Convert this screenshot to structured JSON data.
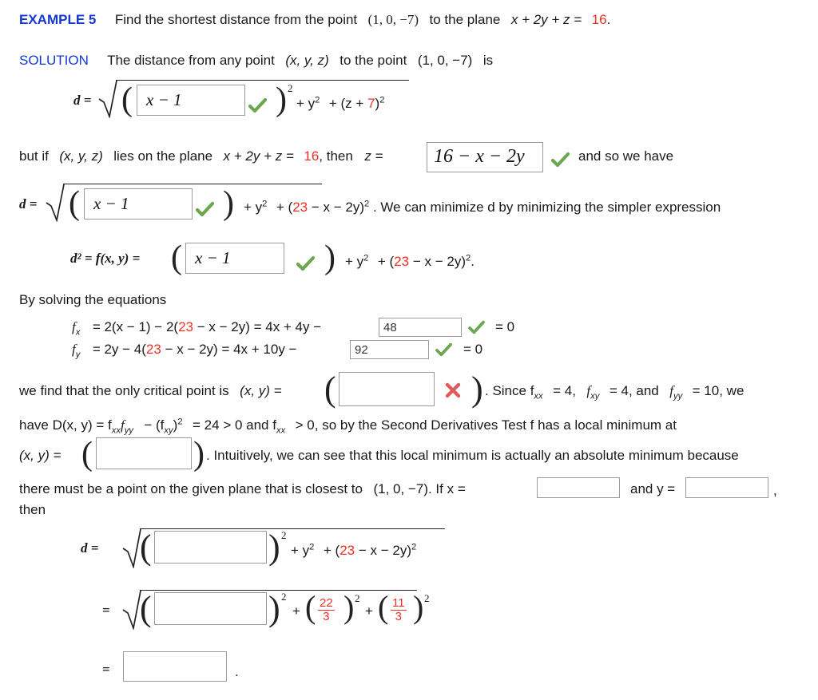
{
  "header": {
    "example_label": "EXAMPLE 5",
    "problem_pre": "Find the shortest distance from the point",
    "problem_point": "(1, 0, −7)",
    "problem_mid": "to the plane",
    "problem_plane": "x + 2y + z =",
    "problem_plane_value": "16",
    "problem_end": "."
  },
  "solution": {
    "label": "SOLUTION",
    "text_pre": "The distance from any point",
    "point_xyz": "(x, y, z)",
    "text_mid": "to the point",
    "point_val": "(1, 0, −7)",
    "text_end": "is"
  },
  "line_d1": {
    "lhs": "d =",
    "answer": "x − 1",
    "mark": "check",
    "after": "+ y",
    "after2": "+ (z +",
    "after_red": "7",
    "after3": ")",
    "exp": "2"
  },
  "line_plane": {
    "pre": "but if",
    "point_xyz": "(x, y, z)",
    "mid": "lies on the plane",
    "plane": "x + 2y + z =",
    "plane_val": "16",
    "then": ", then",
    "z_eq": "z =",
    "answer": "16 − x − 2y",
    "mark": "check",
    "tail": "and so we have"
  },
  "line_d2": {
    "lhs": "d =",
    "answer": "x − 1",
    "mark": "check",
    "mid": "+ y",
    "open": "+ (",
    "red_val": "23",
    "rest": "− x − 2y)",
    "tail": ". We can minimize d by minimizing the simpler expression"
  },
  "line_dsq": {
    "lhs": "d² = f(x, y) =",
    "answer": "x − 1",
    "mark": "check",
    "mid": "+ y",
    "open": "+ (",
    "red_val": "23",
    "rest": "− x − 2y)",
    "tail": "."
  },
  "solving": {
    "intro": "By solving the equations",
    "fx": {
      "name": "f",
      "sub": "x",
      "expr_pre": "= 2(x − 1) − 2(",
      "red_val": "23",
      "expr_mid": "− x − 2y) = 4x + 4y −",
      "answer": "48",
      "mark": "check",
      "result": "= 0"
    },
    "fy": {
      "name": "f",
      "sub": "y",
      "expr_pre": "= 2y − 4(",
      "red_val": "23",
      "expr_mid": "− x − 2y) = 4x + 10y −",
      "answer": "92",
      "mark": "check",
      "result": "= 0"
    }
  },
  "line_crit": {
    "pre": "we find that the only critical point is",
    "xy_eq": "(x, y) =",
    "answer": "",
    "mark": "cross",
    "tail_pre": ". Since f",
    "fxx_sub": "xx",
    "fxx_val": "= 4,",
    "fxy_sub": "xy",
    "fxy_val": "= 4, and",
    "fyy_sub": "yy",
    "fyy_val": "= 10, we"
  },
  "line_D": {
    "text": "have D(x, y) = f",
    "sub1": "xx",
    "sub1b": "f",
    "sub2": "yy",
    "mid": "− (f",
    "sub3": "xy",
    "mid2": ")",
    "exp": "2",
    "mid3": "= 24 > 0 and f",
    "sub4": "xx",
    "tail": "> 0, so by the Second Derivatives Test f has a local minimum at"
  },
  "line_xy2": {
    "lhs": "(x, y) =",
    "answer": "",
    "tail": ". Intuitively, we can see that this local minimum is actually an absolute minimum because"
  },
  "line_point": {
    "pre": "there must be a point on the given plane that is closest to",
    "point_val": "(1, 0, −7)",
    "mid": ". If x =",
    "answer_x": "",
    "and": "and y =",
    "answer_y": "",
    "comma": ",",
    "then": "then"
  },
  "final1": {
    "lhs": "d  =",
    "answer": "",
    "exp": "2",
    "mid": "+ y",
    "open": "+ (",
    "red_val": "23",
    "rest": "− x − 2y)"
  },
  "final2": {
    "lhs": "=",
    "answer": "",
    "exp": "2",
    "plus1": "+",
    "frac1_num": "22",
    "frac1_den": "3",
    "frac1_exp": "2",
    "plus2": "+",
    "frac2_num": "11",
    "frac2_den": "3",
    "frac2_exp": "2"
  },
  "final3": {
    "lhs": "=",
    "answer": "",
    "tail": "."
  },
  "colors": {
    "accent_blue": "#1437d1",
    "accent_red": "#ee3124",
    "check_green": "#6aa84f",
    "cross_red": "#e05c5c",
    "box_border": "#9a9a9a"
  }
}
